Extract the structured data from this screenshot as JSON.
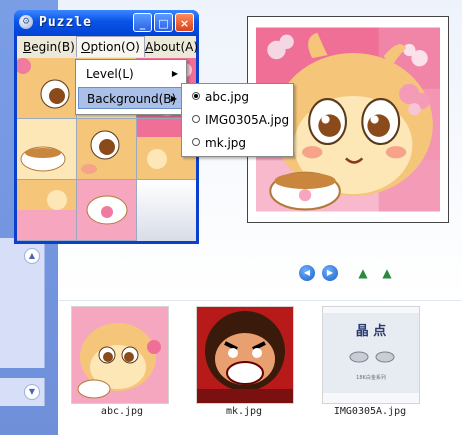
{
  "window": {
    "title": "Puzzle",
    "controls": {
      "minimize": "_",
      "maximize": "□",
      "close": "×"
    }
  },
  "menubar": {
    "begin": {
      "label": "Begin(B)",
      "mnemonic": "B"
    },
    "option": {
      "label": "Option(O)",
      "mnemonic": "O"
    },
    "about": {
      "label": "About(A)",
      "mnemonic": "A"
    }
  },
  "option_menu": {
    "items": [
      {
        "label": "Level(L)",
        "has_submenu": true
      },
      {
        "label": "Background(B)",
        "has_submenu": true,
        "highlighted": true
      }
    ]
  },
  "background_submenu": {
    "items": [
      {
        "label": "abc.jpg",
        "selected": true
      },
      {
        "label": "IMG0305A.jpg",
        "selected": false
      },
      {
        "label": "mk.jpg",
        "selected": false
      }
    ]
  },
  "viewer": {
    "nav_buttons": [
      "previous-icon",
      "next-icon",
      "rotate-left-icon",
      "rotate-right-icon"
    ],
    "left_panel_toggles": [
      "collapse-up-icon",
      "expand-down-icon"
    ]
  },
  "thumbnails": [
    {
      "caption": "abc.jpg"
    },
    {
      "caption": "mk.jpg"
    },
    {
      "caption": "IMG0305A.jpg"
    }
  ],
  "image_text": {
    "img0305a_heading": "晶 点",
    "img0305a_footer": "18K白金系列"
  },
  "colors": {
    "titlebar": "#0a52e6",
    "menu_highlight": "#aac0e8",
    "panel_blue": "#7a9ee6",
    "pink": "#f07aa0",
    "orange": "#f2a95a"
  }
}
